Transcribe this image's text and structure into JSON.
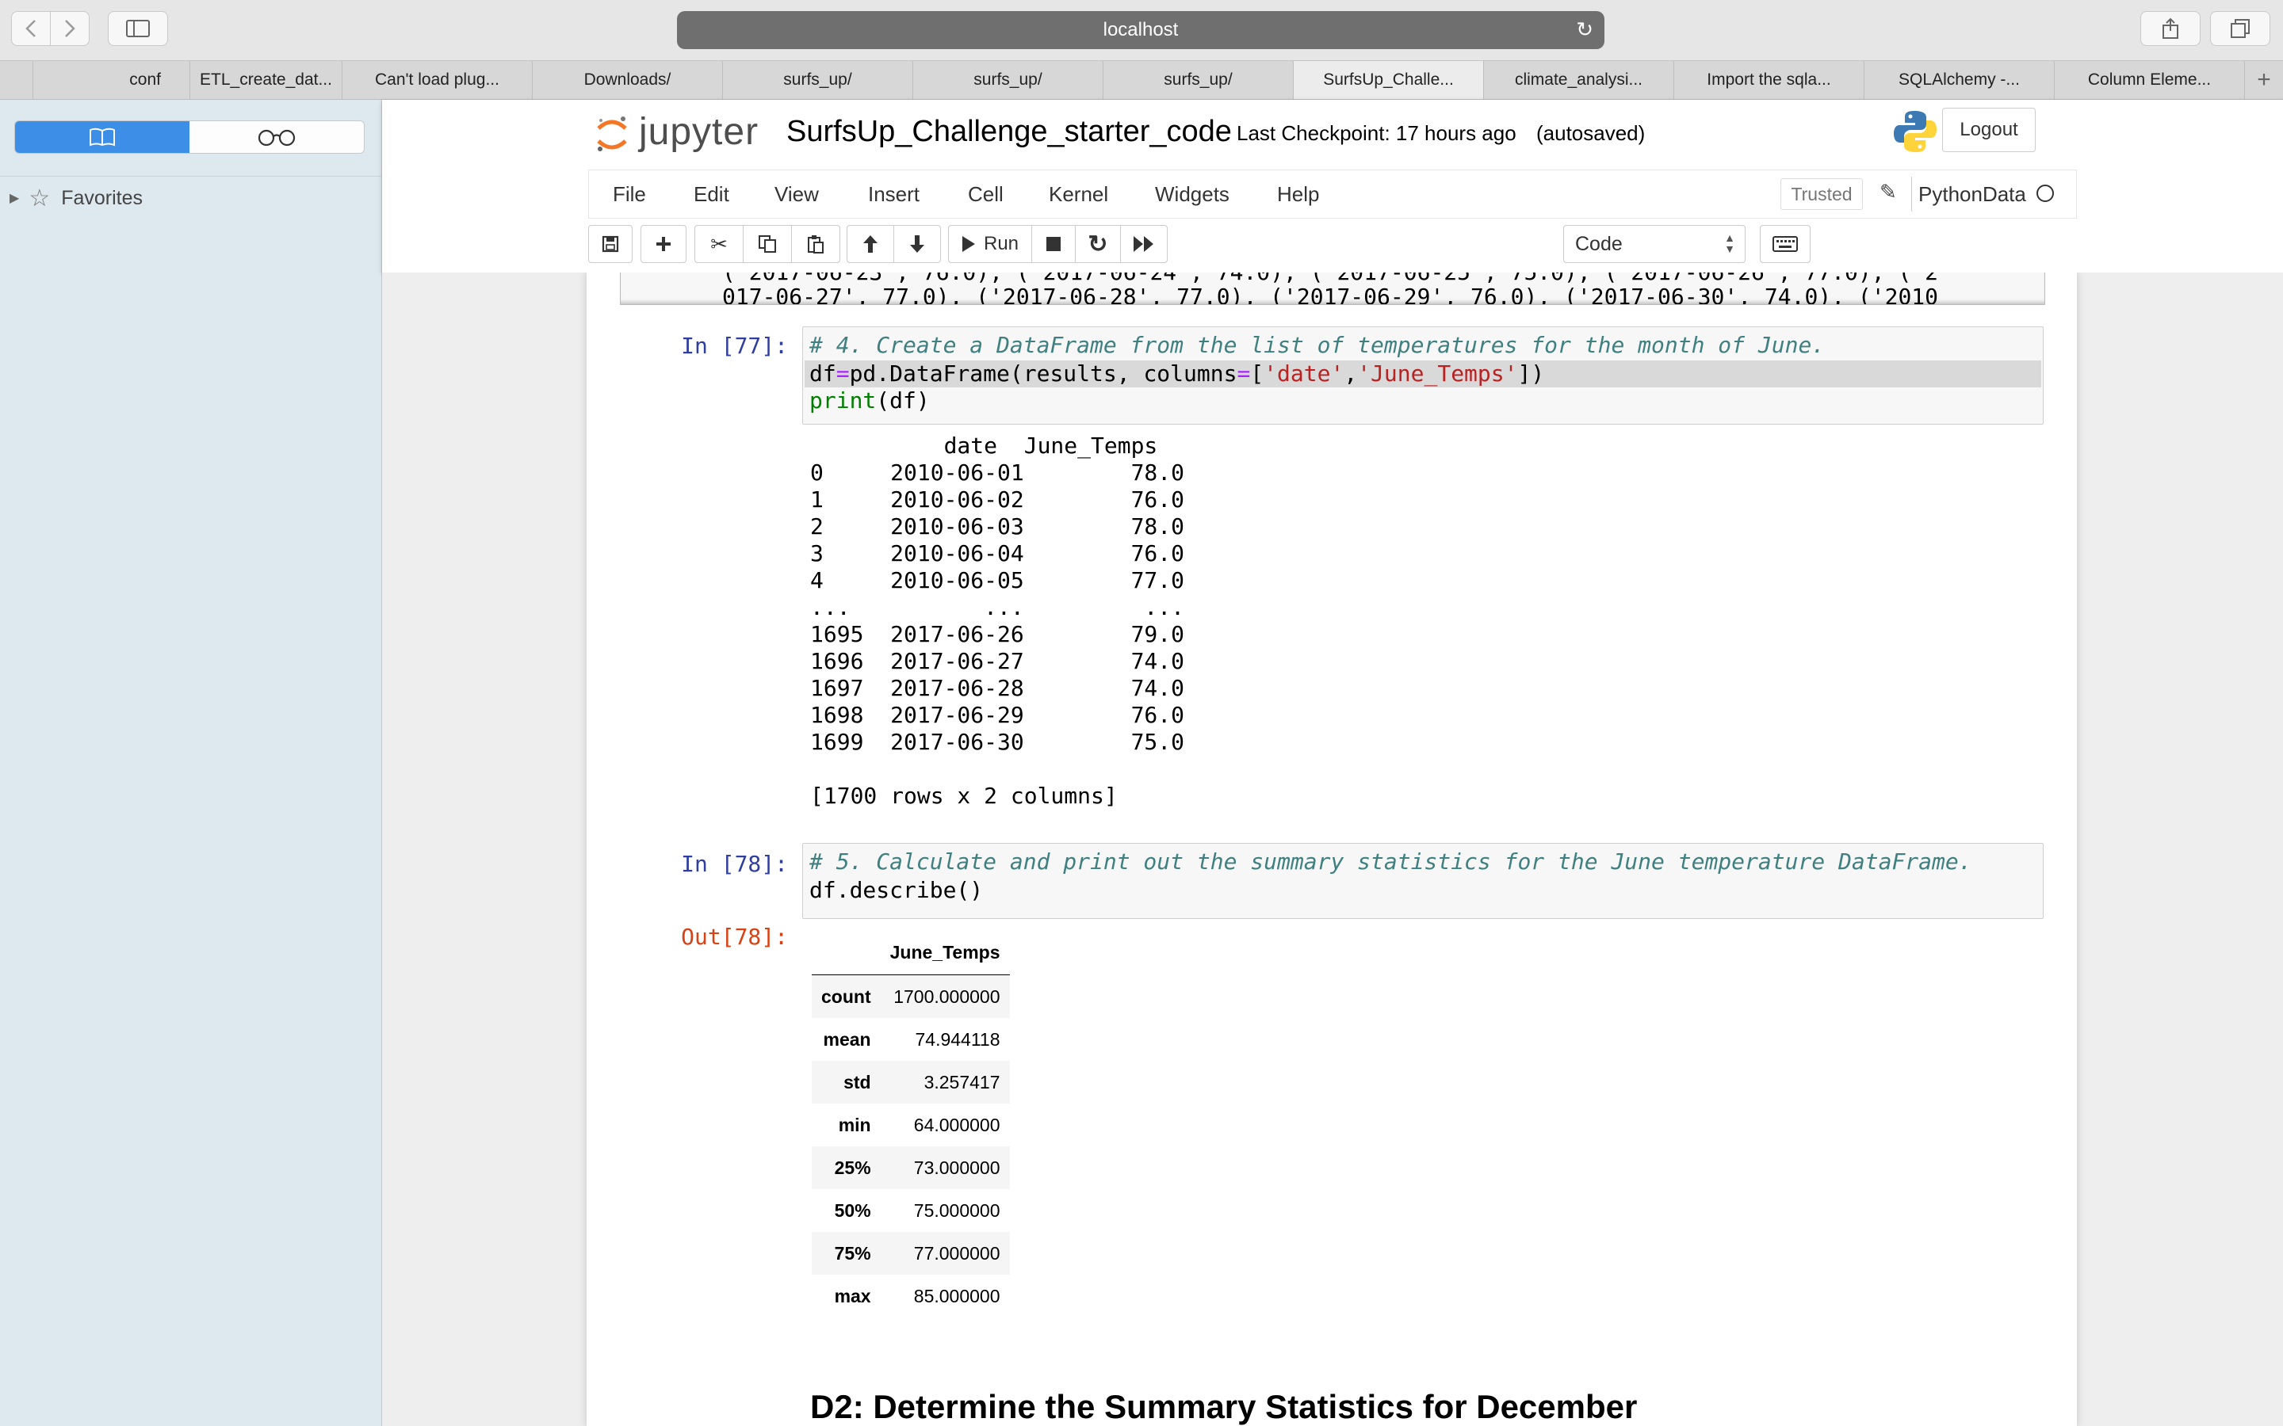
{
  "browser": {
    "url": "localhost",
    "tabs": [
      "",
      "conf",
      "ETL_create_dat...",
      "Can't load plug...",
      "Downloads/",
      "surfs_up/",
      "surfs_up/",
      "surfs_up/",
      "SurfsUp_Challe...",
      "climate_analysi...",
      "Import the sqla...",
      "SQLAlchemy -...",
      "Column Eleme..."
    ],
    "active_tab": "SurfsUp_Challe...",
    "new_tab": "+"
  },
  "sidebar": {
    "favorites_label": "Favorites"
  },
  "jupyter": {
    "logo_text": "jupyter",
    "notebook_title": "SurfsUp_Challenge_starter_code",
    "checkpoint": "Last Checkpoint: 17 hours ago",
    "autosave": "(autosaved)",
    "logout_label": "Logout",
    "menu": [
      "File",
      "Edit",
      "View",
      "Insert",
      "Cell",
      "Kernel",
      "Widgets",
      "Help"
    ],
    "trusted_label": "Trusted",
    "kernel_name": "PythonData",
    "run_label": "Run",
    "cell_type": "Code"
  },
  "notebook": {
    "prev_output_lines": [
      "('2017-06-23', 76.0), ('2017-06-24', 74.0), ('2017-06-25', 75.0), ('2017-06-26', 77.0), ('2",
      "017-06-27', 77.0), ('2017-06-28', 77.0), ('2017-06-29', 76.0), ('2017-06-30', 74.0), ('2010"
    ],
    "cell77": {
      "prompt": "In [77]:",
      "code": {
        "comment": "# 4. Create a DataFrame from the list of temperatures for the month of June.",
        "l2_a": "df",
        "l2_op1": "=",
        "l2_b": "pd.DataFrame(results, columns",
        "l2_op2": "=",
        "l2_c": "[",
        "l2_s1": "'date'",
        "l2_d": ",",
        "l2_s2": "'June_Temps'",
        "l2_e": "])",
        "l3_fn": "print",
        "l3_rest": "(df)"
      },
      "output_lines": [
        "          date  June_Temps",
        "0     2010-06-01        78.0",
        "1     2010-06-02        76.0",
        "2     2010-06-03        78.0",
        "3     2010-06-04        76.0",
        "4     2010-06-05        77.0",
        "...          ...         ...",
        "1695  2017-06-26        79.0",
        "1696  2017-06-27        74.0",
        "1697  2017-06-28        74.0",
        "1698  2017-06-29        76.0",
        "1699  2017-06-30        75.0",
        "",
        "[1700 rows x 2 columns]"
      ]
    },
    "cell78": {
      "prompt": "In [78]:",
      "out_prompt": "Out[78]:",
      "comment": "# 5. Calculate and print out the summary statistics for the June temperature DataFrame.",
      "code": "df.describe()",
      "table": {
        "column": "June_Temps",
        "rows": [
          {
            "label": "count",
            "value": "1700.000000"
          },
          {
            "label": "mean",
            "value": "74.944118"
          },
          {
            "label": "std",
            "value": "3.257417"
          },
          {
            "label": "min",
            "value": "64.000000"
          },
          {
            "label": "25%",
            "value": "73.000000"
          },
          {
            "label": "50%",
            "value": "75.000000"
          },
          {
            "label": "75%",
            "value": "77.000000"
          },
          {
            "label": "max",
            "value": "85.000000"
          }
        ]
      }
    },
    "heading": "D2: Determine the Summary Statistics for December"
  }
}
